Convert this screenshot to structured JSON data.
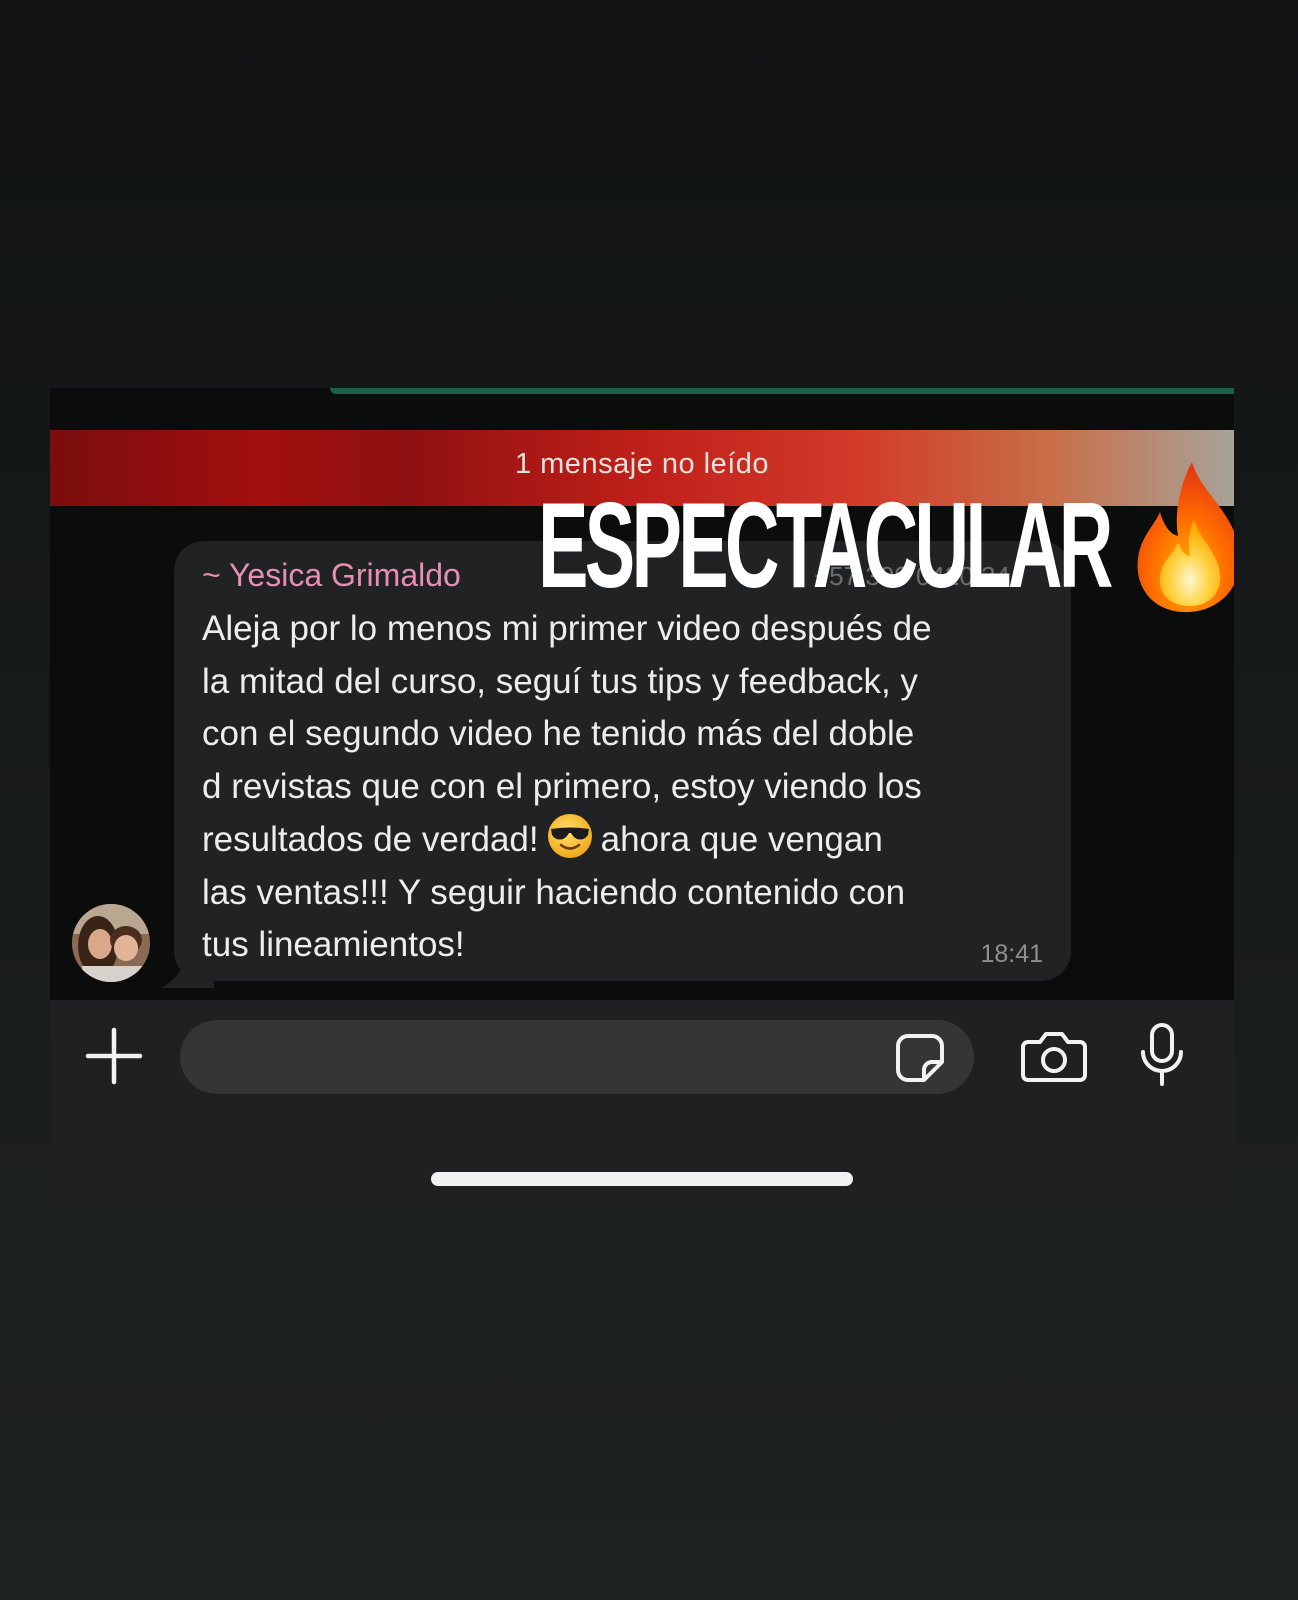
{
  "overlay": {
    "headline": "ESPECTACULAR",
    "fire_icon": "fire-emoji"
  },
  "chat": {
    "unread_banner": "1 mensaje no leído",
    "message": {
      "sender": "~ Yesica Grimaldo",
      "sender_phone": "+57 300 0420 34",
      "lines": [
        "Aleja por lo menos mi primer video después de",
        "la mitad del curso, seguí tus tips y feedback, y",
        "con el segundo video he tenido más del doble",
        "d revistas que con el primero, estoy viendo los",
        "resultados de verdad!",
        "ahora que vengan",
        "las ventas!!! Y seguir haciendo contenido con",
        "tus lineamientos!"
      ],
      "emoji": "smiling-face-with-sunglasses",
      "time": "18:41"
    }
  },
  "input_bar": {
    "icons": [
      "plus-icon",
      "sticker-icon",
      "camera-icon",
      "microphone-icon"
    ]
  },
  "colors": {
    "background": "#16191a",
    "bubble": "#202223",
    "sender_name": "#e58fb5",
    "input_bar": "#1e2021",
    "text_field": "#333536"
  }
}
